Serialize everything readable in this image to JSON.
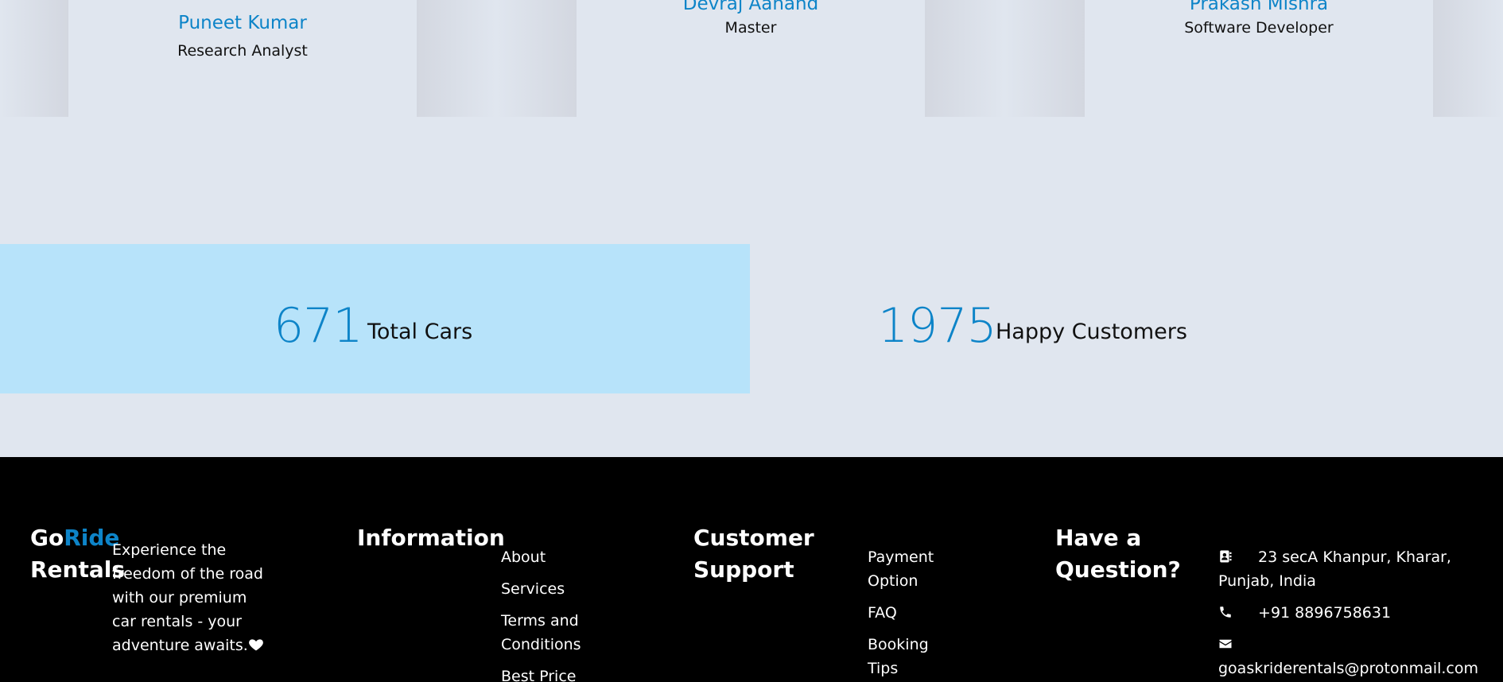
{
  "team": [
    {
      "name": "Puneet Kumar",
      "role": "Research Analyst"
    },
    {
      "name": "Devraj Aanand",
      "role": "Master"
    },
    {
      "name": "Prakash Mishra",
      "role": "Software Developer"
    }
  ],
  "stats": [
    {
      "value": "671",
      "label": "Total Cars"
    },
    {
      "value": "1975",
      "label": "Happy Customers"
    }
  ],
  "footer": {
    "brand_go": "Go",
    "brand_ride": "Ride",
    "brand_rentals": "Rentals",
    "tagline": "Experience the freedom of the road with our premium car rentals - your adventure awaits.",
    "heart_icon": "heart-icon",
    "information": {
      "heading": "Information",
      "links": [
        "About",
        "Services",
        "Terms and Conditions",
        "Best Price"
      ]
    },
    "support": {
      "heading": "Customer Support",
      "links": [
        "Payment Option",
        "FAQ",
        "Booking Tips"
      ]
    },
    "contact": {
      "heading": "Have a Question?",
      "address": "23 secA Khanpur, Kharar, Punjab, India",
      "phone": "+91 8896758631",
      "email": "goaskriderentals@protonmail.com"
    }
  },
  "colors": {
    "accent": "#0d84c8",
    "stat_highlight": "#b7e3fa",
    "page_bg": "#e0e6ef",
    "footer_bg": "#000000"
  }
}
